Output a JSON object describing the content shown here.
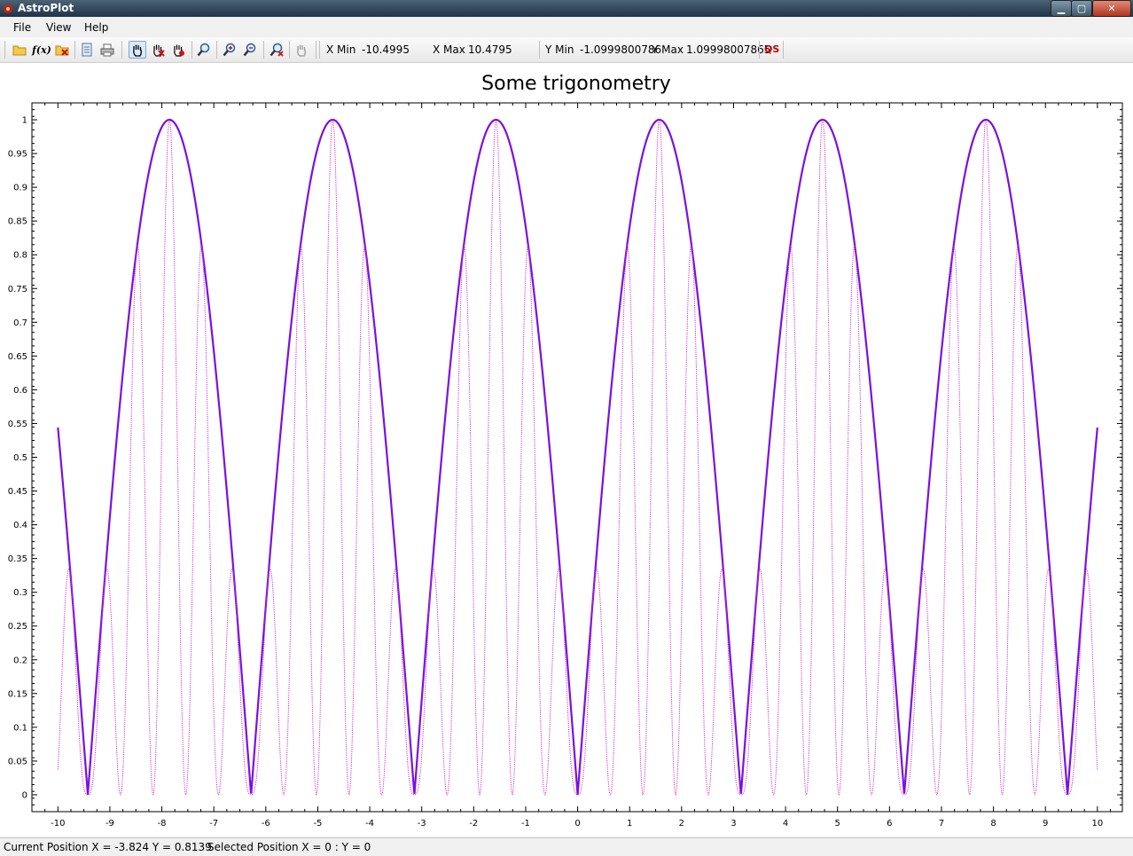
{
  "window": {
    "title": "AstroPlot"
  },
  "menu": {
    "items": [
      "File",
      "View",
      "Help"
    ]
  },
  "toolbar": {
    "icons": [
      "open-folder-icon",
      "function-icon",
      "close-folder-icon",
      "export-icon",
      "print-icon",
      "pan-hand-icon",
      "delete-point-icon",
      "move-point-icon",
      "magnifier-icon",
      "zoom-in-icon",
      "zoom-out-icon",
      "zoom-reset-icon",
      "grab-hand-icon"
    ],
    "function_label": "f(x)",
    "xmin_label": "X Min",
    "xmin_value": "-10.4995",
    "xmax_label": "X Max",
    "xmax_value": "10.4795",
    "ymin_label": "Y Min",
    "ymin_value": "-1.0999800786",
    "ymax_label": "Y Max",
    "ymax_value": "1.09998007865",
    "qs_label": "QS"
  },
  "status": {
    "current_position": "Current Position X = -3.824 Y = 0.8139",
    "selected_position": "Selected Position  X = 0 : Y = 0"
  },
  "colors": {
    "series1": "#7b10e0",
    "series2": "#cc33cc",
    "titlebar": "#2b4356"
  },
  "chart_data": {
    "type": "line",
    "title": "Some trigonometry",
    "xlim": [
      -10.5,
      10.48
    ],
    "ylim": [
      -0.025,
      1.025
    ],
    "x_ticks": [
      -10,
      -9,
      -8,
      -7,
      -6,
      -5,
      -4,
      -3,
      -2,
      -1,
      0,
      1,
      2,
      3,
      4,
      5,
      6,
      7,
      8,
      9,
      10
    ],
    "y_ticks": [
      0,
      0.05,
      0.1,
      0.15,
      0.2,
      0.25,
      0.3,
      0.35,
      0.4,
      0.45,
      0.5,
      0.55,
      0.6,
      0.65,
      0.7,
      0.75,
      0.8,
      0.85,
      0.9,
      0.95,
      1
    ],
    "x_range": [
      -10,
      10
    ],
    "series": [
      {
        "expr": "abs(sin(x))",
        "style": "solid",
        "color": "#7b10e0"
      },
      {
        "expr": "abs(sin(x))*(sin(5*x))^2",
        "style": "dotted",
        "color": "#cc33cc"
      }
    ],
    "grid": false
  }
}
